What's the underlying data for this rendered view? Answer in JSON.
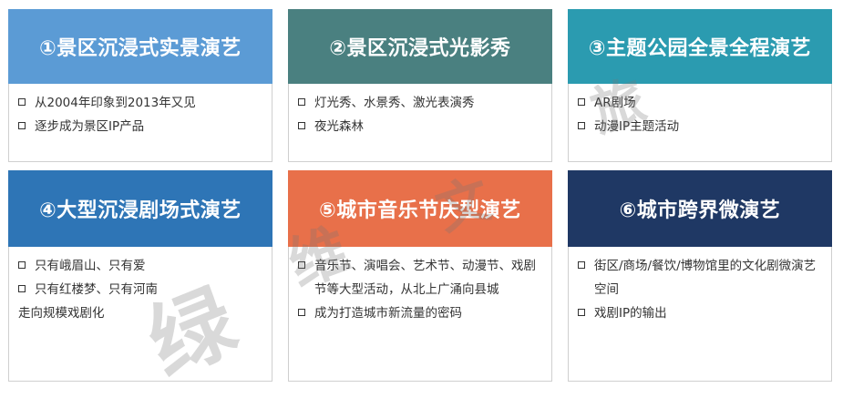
{
  "colors": {
    "card1": "#5b9bd5",
    "card2": "#4a8080",
    "card3": "#2b9bb0",
    "card4": "#2e75b6",
    "card5": "#e8704a",
    "card6": "#1f3864"
  },
  "cards": [
    {
      "title": "①景区沉浸式实景演艺",
      "bullets": [
        "从2004年印象到2013年又见",
        "逐步成为景区IP产品"
      ]
    },
    {
      "title": "②景区沉浸式光影秀",
      "bullets": [
        "灯光秀、水景秀、激光表演秀",
        "夜光森林"
      ]
    },
    {
      "title": "③主题公园全景全程演艺",
      "bullets": [
        "AR剧场",
        "动漫IP主题活动"
      ]
    },
    {
      "title": "④大型沉浸剧场式演艺",
      "bullets": [
        "只有峨眉山、只有爱",
        "只有红楼梦、只有河南"
      ],
      "continuation": "走向规模戏剧化"
    },
    {
      "title": "⑤城市音乐节庆型演艺",
      "bullets": [
        "音乐节、演唱会、艺术节、动漫节、戏剧节等大型活动，从北上广涌向县城",
        "成为打造城市新流量的密码"
      ]
    },
    {
      "title": "⑥城市跨界微演艺",
      "bullets": [
        "街区/商场/餐饮/博物馆里的文化剧微演艺空间",
        "戏剧IP的输出"
      ]
    }
  ],
  "watermark": [
    "绿",
    "维",
    "文",
    "旅"
  ]
}
